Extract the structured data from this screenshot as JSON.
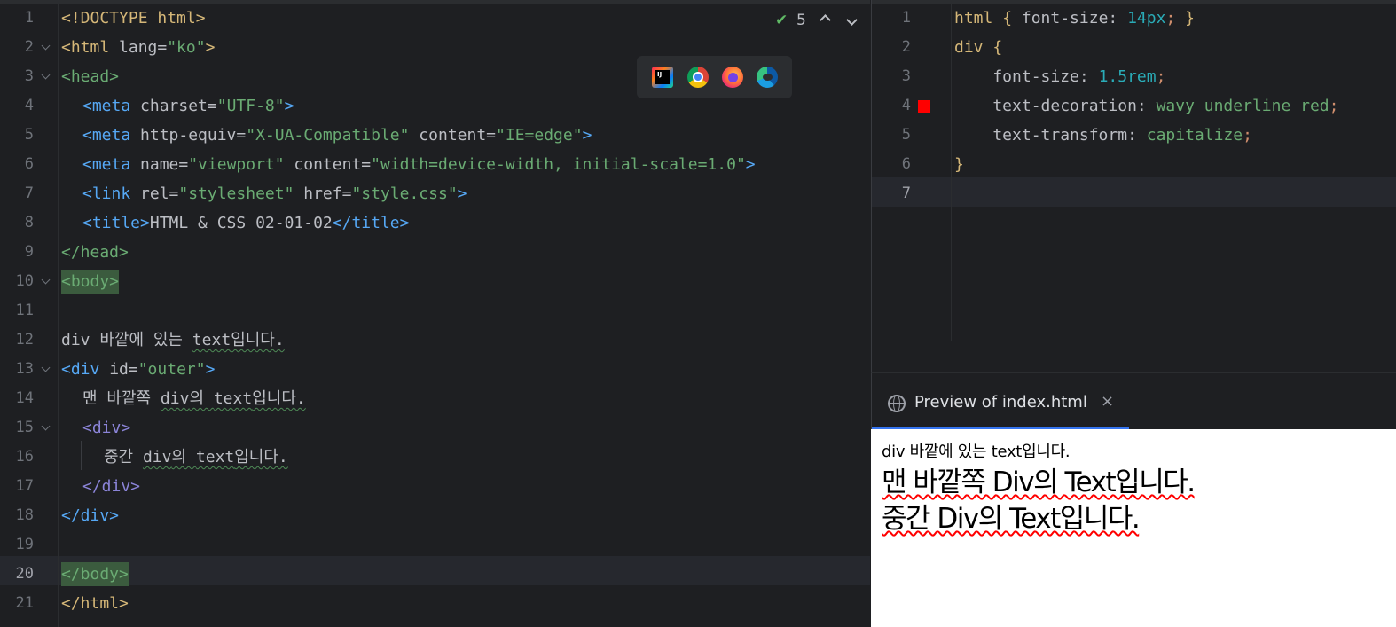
{
  "left_editor": {
    "lines": [
      {
        "n": "1"
      },
      {
        "n": "2"
      },
      {
        "n": "3"
      },
      {
        "n": "4"
      },
      {
        "n": "5"
      },
      {
        "n": "6"
      },
      {
        "n": "7"
      },
      {
        "n": "8"
      },
      {
        "n": "9"
      },
      {
        "n": "10"
      },
      {
        "n": "11"
      },
      {
        "n": "12"
      },
      {
        "n": "13"
      },
      {
        "n": "14"
      },
      {
        "n": "15"
      },
      {
        "n": "16"
      },
      {
        "n": "17"
      },
      {
        "n": "18"
      },
      {
        "n": "19"
      },
      {
        "n": "20"
      },
      {
        "n": "21"
      }
    ],
    "code": {
      "l1_doctype": "<!DOCTYPE html>",
      "l2_open": "<html",
      "l2_attr": " lang=",
      "l2_val": "\"ko\"",
      "l2_close": ">",
      "l3": "<head>",
      "l4_tag": "<meta",
      "l4_attr": " charset=",
      "l4_val": "\"UTF-8\"",
      "l4_close": ">",
      "l5_tag": "<meta",
      "l5_attr1": " http-equiv=",
      "l5_val1": "\"X-UA-Compatible\"",
      "l5_attr2": " content=",
      "l5_val2": "\"IE=edge\"",
      "l5_close": ">",
      "l6_tag": "<meta",
      "l6_attr1": " name=",
      "l6_val1": "\"viewport\"",
      "l6_attr2": " content=",
      "l6_val2": "\"width=device-width, initial-scale=1.0\"",
      "l6_close": ">",
      "l7_tag": "<link",
      "l7_attr1": " rel=",
      "l7_val1": "\"stylesheet\"",
      "l7_attr2": " href=",
      "l7_val2": "\"style.css\"",
      "l7_close": ">",
      "l8_open": "<title>",
      "l8_text": "HTML & CSS 02-01-02",
      "l8_close": "</title>",
      "l9": "</head>",
      "l10": "<body>",
      "l12_a": "div 바깥에 있는 ",
      "l12_b": "text",
      "l12_c": "입니다.",
      "l13_tag": "<div",
      "l13_attr": " id=",
      "l13_val": "\"outer\"",
      "l13_close": ">",
      "l14_a": "맨 바깥쪽 ",
      "l14_b": "div",
      "l14_c": "의 ",
      "l14_d": "text",
      "l14_e": "입니다.",
      "l15": "<div>",
      "l16_a": "중간 ",
      "l16_b": "div",
      "l16_c": "의 ",
      "l16_d": "text",
      "l16_e": "입니다.",
      "l17": "</div>",
      "l18": "</div>",
      "l20": "</body>",
      "l21": "</html>"
    },
    "inspection": {
      "count": "5"
    },
    "browsers": [
      "intellij-icon",
      "chrome-icon",
      "firefox-icon",
      "edge-icon"
    ],
    "ij_label": "IJ"
  },
  "right_editor": {
    "lines": [
      {
        "n": "1"
      },
      {
        "n": "2"
      },
      {
        "n": "3"
      },
      {
        "n": "4"
      },
      {
        "n": "5"
      },
      {
        "n": "6"
      },
      {
        "n": "7"
      }
    ],
    "code": {
      "l1_sel": "html",
      "l1_open": " { ",
      "l1_prop": "font-size: ",
      "l1_num": "14px",
      "l1_semi": ";",
      "l1_close": " }",
      "l2_sel": "div",
      "l2_open": " {",
      "l3_prop": "    font-size: ",
      "l3_num": "1.5rem",
      "l3_semi": ";",
      "l4_prop": "    text-decoration: ",
      "l4_val": "wavy underline red",
      "l4_semi": ";",
      "l5_prop": "    text-transform: ",
      "l5_val": "capitalize",
      "l5_semi": ";",
      "l6": "}"
    },
    "color_swatch": "#ff0000"
  },
  "preview": {
    "tab_label": "Preview of index.html",
    "close": "×",
    "outside_text": "div 바깥에 있는 text입니다.",
    "outer_text": "맨 바깥쪽 Div의 Text입니다.",
    "middle_text": "중간 Div의 Text입니다."
  }
}
